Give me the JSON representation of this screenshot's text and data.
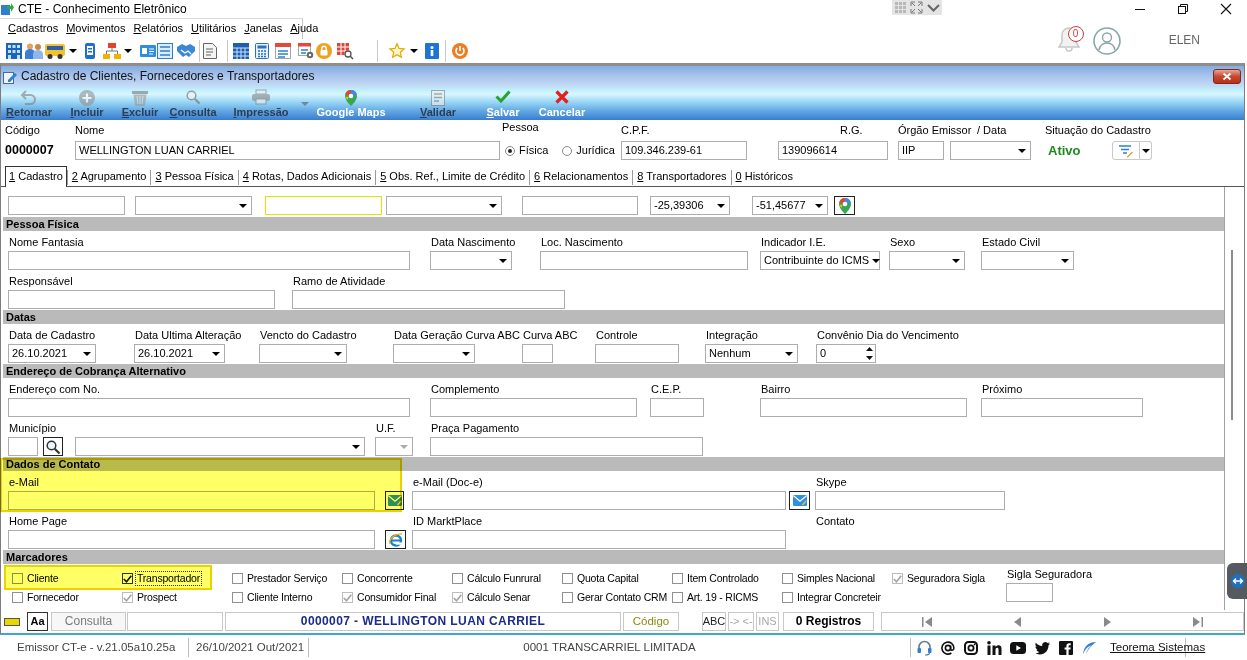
{
  "app": {
    "title": "CTE - Conhecimento Eletrônico",
    "menu": [
      "Cadastros",
      "Movimentos",
      "Relatórios",
      "Utilitários",
      "Janelas",
      "Ajuda"
    ],
    "notifications": "0",
    "user": "ELEN"
  },
  "form": {
    "title": "Cadastro de Clientes, Fornecedores e Transportadores",
    "actions": [
      {
        "label": "Retornar",
        "disabled": true,
        "mnemonic": true
      },
      {
        "label": "Incluir",
        "disabled": true,
        "mnemonic": true
      },
      {
        "label": "Excluir",
        "disabled": true,
        "mnemonic": true
      },
      {
        "label": "Consulta",
        "disabled": true,
        "mnemonic": true
      },
      {
        "label": "Impressão",
        "disabled": true,
        "mnemonic": true
      },
      {
        "label": "Google Maps",
        "disabled": false,
        "mnemonic": false
      },
      {
        "label": "Validar",
        "disabled": true,
        "mnemonic": true
      },
      {
        "label": "Salvar",
        "disabled": false,
        "mnemonic": true
      },
      {
        "label": "Cancelar",
        "disabled": false,
        "mnemonic": false
      }
    ],
    "header": {
      "code": {
        "label": "Código",
        "value": "0000007"
      },
      "name": {
        "label": "Nome",
        "value": "WELLINGTON LUAN CARRIEL"
      },
      "person_type": {
        "label": "Pessoa",
        "options": [
          {
            "label": "Física",
            "selected": true
          },
          {
            "label": "Jurídica",
            "selected": false
          }
        ]
      },
      "cpf": {
        "label": "C.P.F.",
        "value": "109.346.239-61"
      },
      "rg": {
        "label": "R.G.",
        "value": "139096614"
      },
      "issuer": {
        "label": "Órgão Emissor",
        "value": "IIP"
      },
      "issue_date": {
        "label": "/ Data"
      },
      "status": {
        "label": "Situação do Cadastro",
        "value": "Ativo"
      }
    },
    "tabs": [
      {
        "label": "1 Cadastro",
        "selected": true
      },
      {
        "label": "2 Agrupamento",
        "selected": false
      },
      {
        "label": "3 Pessoa Física",
        "selected": false
      },
      {
        "label": "4 Rotas, Dados Adicionais",
        "selected": false
      },
      {
        "label": "5 Obs. Ref., Limite de Crédito",
        "selected": false
      },
      {
        "label": "6 Relacionamentos",
        "selected": false
      },
      {
        "label": "8 Transportadores",
        "selected": false
      },
      {
        "label": "0 Históricos",
        "selected": false
      }
    ],
    "rows": [
      {
        "kind": "fields",
        "groups": [
          {
            "controls": [
              {
                "kind": "input",
                "focused": false
              }
            ]
          },
          {
            "controls": [
              {
                "kind": "select",
                "focused": false
              }
            ]
          },
          {
            "controls": [
              {
                "kind": "input",
                "focused": true
              }
            ]
          },
          {
            "controls": [
              {
                "kind": "select",
                "focused": false
              }
            ]
          },
          {
            "controls": [
              {
                "kind": "input",
                "focused": false
              }
            ]
          },
          {
            "controls": [
              {
                "kind": "select",
                "value": "-25,39306",
                "focused": false
              }
            ]
          },
          {
            "controls": [
              {
                "kind": "select",
                "value": "-51,45677",
                "focused": false
              }
            ]
          },
          {
            "controls": [
              {
                "kind": "map-button",
                "focused": false
              }
            ]
          }
        ]
      },
      {
        "kind": "section",
        "title": "Pessoa Física"
      },
      {
        "kind": "fields",
        "groups": [
          {
            "label": "Nome Fantasia",
            "controls": [
              {
                "kind": "input"
              }
            ]
          },
          {
            "label": "Data Nascimento",
            "controls": [
              {
                "kind": "select"
              }
            ]
          },
          {
            "label": "Loc. Nascimento",
            "controls": [
              {
                "kind": "input"
              }
            ]
          },
          {
            "label": "Indicador I.E.",
            "controls": [
              {
                "kind": "select",
                "value": "Contribuinte do ICMS"
              }
            ]
          },
          {
            "label": "Sexo",
            "controls": [
              {
                "kind": "select"
              }
            ]
          },
          {
            "label": "Estado Civil",
            "controls": [
              {
                "kind": "select"
              }
            ]
          }
        ]
      },
      {
        "kind": "fields",
        "groups": [
          {
            "label": "Responsável",
            "controls": [
              {
                "kind": "input"
              }
            ]
          },
          {
            "label": "Ramo de Atividade",
            "controls": [
              {
                "kind": "input"
              }
            ]
          }
        ]
      },
      {
        "kind": "section",
        "title": "Datas"
      },
      {
        "kind": "fields",
        "groups": [
          {
            "label": "Data de Cadastro",
            "controls": [
              {
                "kind": "select",
                "value": "26.10.2021"
              }
            ]
          },
          {
            "label": "Data Ultima Alteração",
            "controls": [
              {
                "kind": "select",
                "value": "26.10.2021"
              }
            ]
          },
          {
            "label": "Vencto do Cadastro",
            "controls": [
              {
                "kind": "select"
              }
            ]
          },
          {
            "label": "Data Geração Curva ABC",
            "controls": [
              {
                "kind": "select"
              }
            ]
          },
          {
            "label": "Curva ABC",
            "controls": [
              {
                "kind": "input"
              }
            ]
          },
          {
            "label": "Controle",
            "controls": [
              {
                "kind": "input"
              }
            ]
          },
          {
            "label": "Integração",
            "controls": [
              {
                "kind": "select",
                "value": "Nenhum"
              }
            ]
          },
          {
            "label": "Convênio Dia do Vencimento",
            "controls": [
              {
                "kind": "spinner",
                "value": "0"
              }
            ]
          }
        ]
      },
      {
        "kind": "section",
        "title": "Endereço de Cobrança Alternativo"
      },
      {
        "kind": "fields",
        "groups": [
          {
            "label": "Endereço com No.",
            "controls": [
              {
                "kind": "input"
              }
            ]
          },
          {
            "label": "Complemento",
            "controls": [
              {
                "kind": "input"
              }
            ]
          },
          {
            "label": "C.E.P.",
            "controls": [
              {
                "kind": "input"
              }
            ]
          },
          {
            "label": "Bairro",
            "controls": [
              {
                "kind": "input"
              }
            ]
          },
          {
            "label": "Próximo",
            "controls": [
              {
                "kind": "input"
              }
            ]
          }
        ]
      },
      {
        "kind": "fields",
        "groups": [
          {
            "label": "Município",
            "controls": [
              {
                "kind": "input"
              },
              {
                "kind": "search-button"
              },
              {
                "kind": "select"
              }
            ]
          },
          {
            "label": "U.F.",
            "controls": [
              {
                "kind": "select",
                "disabled": true
              }
            ]
          },
          {
            "label": "Praça Pagamento",
            "controls": [
              {
                "kind": "input"
              }
            ]
          }
        ]
      },
      {
        "kind": "section",
        "title": "Dados de Contato"
      },
      {
        "kind": "fields",
        "groups": [
          {
            "label": "e-Mail",
            "highlighted": true,
            "controls": [
              {
                "kind": "input"
              },
              {
                "kind": "mail-button"
              }
            ]
          },
          {
            "label": "e-Mail (Doc-e)",
            "highlighted": false,
            "controls": [
              {
                "kind": "input"
              },
              {
                "kind": "mail-button"
              }
            ]
          },
          {
            "label": "Skype",
            "highlighted": false,
            "controls": [
              {
                "kind": "input"
              }
            ]
          }
        ]
      },
      {
        "kind": "fields",
        "groups": [
          {
            "label": "Home Page",
            "controls": [
              {
                "kind": "input"
              },
              {
                "kind": "web-button"
              }
            ]
          },
          {
            "label": "ID MarktPlace",
            "controls": [
              {
                "kind": "input"
              }
            ]
          },
          {
            "label": "Contato"
          }
        ]
      },
      {
        "kind": "section",
        "title": "Marcadores"
      }
    ],
    "markers": {
      "checkboxes": [
        {
          "label": "Cliente",
          "checked": false,
          "disabled": false,
          "focused": false,
          "highlighted": true
        },
        {
          "label": "Transportador",
          "checked": true,
          "disabled": false,
          "focused": true,
          "highlighted": true
        },
        {
          "label": "Prestador Serviço",
          "checked": false,
          "disabled": false,
          "focused": false,
          "highlighted": false
        },
        {
          "label": "Concorrente",
          "checked": false,
          "disabled": false,
          "focused": false,
          "highlighted": false
        },
        {
          "label": "Cálculo Funrural",
          "checked": false,
          "disabled": false,
          "focused": false,
          "highlighted": false
        },
        {
          "label": "Quota Capital",
          "checked": false,
          "disabled": false,
          "focused": false,
          "highlighted": false
        },
        {
          "label": "Item Controlado",
          "checked": false,
          "disabled": false,
          "focused": false,
          "highlighted": false
        },
        {
          "label": "Simples Nacional",
          "checked": false,
          "disabled": false,
          "focused": false,
          "highlighted": false
        },
        {
          "label": "Seguradora Sigla",
          "checked": true,
          "disabled": true,
          "focused": false,
          "highlighted": false
        },
        {
          "label": "Fornecedor",
          "checked": false,
          "disabled": false,
          "focused": false,
          "highlighted": false
        },
        {
          "label": "Prospect",
          "checked": true,
          "disabled": true,
          "focused": false,
          "highlighted": false
        },
        {
          "label": "Cliente Interno",
          "checked": false,
          "disabled": false,
          "focused": false,
          "highlighted": false
        },
        {
          "label": "Consumidor Final",
          "checked": true,
          "disabled": true,
          "focused": false,
          "highlighted": false
        },
        {
          "label": "Cálculo Senar",
          "checked": true,
          "disabled": true,
          "focused": false,
          "highlighted": false
        },
        {
          "label": "Gerar Contato CRM",
          "checked": false,
          "disabled": false,
          "focused": false,
          "highlighted": false
        },
        {
          "label": "Art. 19 - RICMS",
          "checked": false,
          "disabled": false,
          "focused": false,
          "highlighted": false
        },
        {
          "label": "Integrar Concreteir",
          "checked": false,
          "disabled": false,
          "focused": false,
          "highlighted": false
        }
      ],
      "insurer_code": {
        "label": "Sigla Seguradora"
      }
    },
    "navbar": {
      "font_button": "Aa",
      "mode": "Consulta",
      "record": "0000007 - WELLINGTON LUAN CARRIEL",
      "order": "Código",
      "indicators": [
        {
          "label": "ABC",
          "on": true
        },
        {
          "label": "-> <-",
          "on": false
        },
        {
          "label": "INS",
          "on": false
        }
      ],
      "count": "0 Registros"
    }
  },
  "status_bar": {
    "version": "Emissor CT-e - v.21.05a10.25a",
    "date": "26/10/2021 Out/2021",
    "company": "0001 TRANSCARRIEL LIMITADA",
    "link": "Teorema Sistemas"
  }
}
